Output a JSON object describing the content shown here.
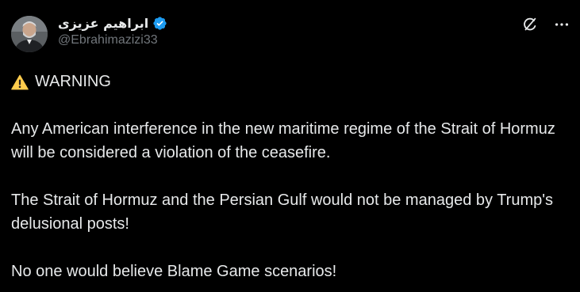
{
  "author": {
    "display_name": "ابراهیم عزیزی",
    "handle": "@Ebrahimazizi33",
    "verified": true,
    "avatar_icon": "profile-photo"
  },
  "actions": {
    "grok_icon": "grok-icon",
    "more_icon": "more-icon"
  },
  "post": {
    "warning_icon": "warning-icon",
    "warning_label": "WARNING",
    "paragraphs": [
      "Any American interference in the new maritime regime of the Strait of Hormuz will be considered a violation of the ceasefire.",
      "The Strait of Hormuz and the Persian Gulf would not be managed by Trump's delusional posts!",
      "No one would believe Blame Game scenarios!"
    ]
  },
  "colors": {
    "background": "#000000",
    "text": "#e7e9ea",
    "muted": "#71767b",
    "verified": "#1d9bf0",
    "warning": "#ffcc4d"
  }
}
